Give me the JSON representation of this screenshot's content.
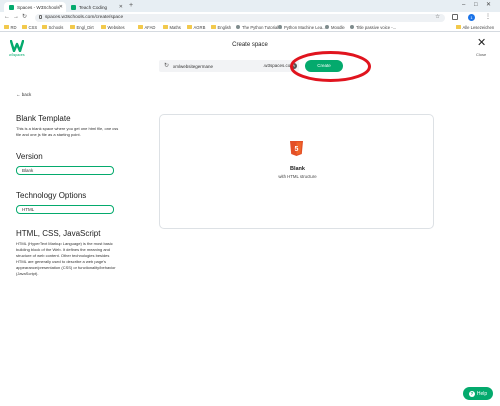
{
  "browser": {
    "tabs": [
      {
        "title": "Spaces - W3Schools",
        "active": true
      },
      {
        "title": "Teach Coding",
        "active": false
      }
    ],
    "url": "spaces.w3schools.com/create/space",
    "profile_initial": "1",
    "bookmarks": [
      "RD",
      "CSS",
      "Schools",
      "Engl_Dirt",
      "Websites",
      "AFAD",
      "Maths",
      "AGRB",
      "English",
      "The Python Tutorial...",
      "Python Machine Lea...",
      "Moodle",
      "Title passive voice -..."
    ],
    "all_bookmarks_label": "Alle Lesezeichen"
  },
  "header": {
    "logo_sub": "w3spaces",
    "title": "Create space",
    "close_label": "Close",
    "space_name_value": "xmlwebsitegermane",
    "domain_suffix": ".w3spaces.com",
    "create_label": "Create"
  },
  "sidebar": {
    "back_label": "back",
    "template_title": "Blank Template",
    "template_desc": "This is a blank space where you get one html file, one css file and one js file as a starting point.",
    "version_title": "Version",
    "version_value": "Blank",
    "tech_title": "Technology Options",
    "tech_value": "HTML",
    "stack_title": "HTML, CSS, JavaScript",
    "stack_desc": "HTML (HyperText Markup Language) is the most basic building block of the Web. It defines the meaning and structure of web content. Other technologies besides HTML are generally used to describe a web page's appearance/presentation (CSS) or functionality/behavior (JavaScript)."
  },
  "card": {
    "badge_text": "5",
    "title": "Blank",
    "subtitle": "with HTML structure"
  },
  "help": {
    "label": "Help"
  },
  "colors": {
    "accent": "#04aa6d",
    "annotation": "#e0141e"
  },
  "icons": [
    "lock-icon",
    "star-icon",
    "refresh-icon",
    "pencil-icon",
    "close-icon",
    "html5-icon",
    "help-icon"
  ]
}
